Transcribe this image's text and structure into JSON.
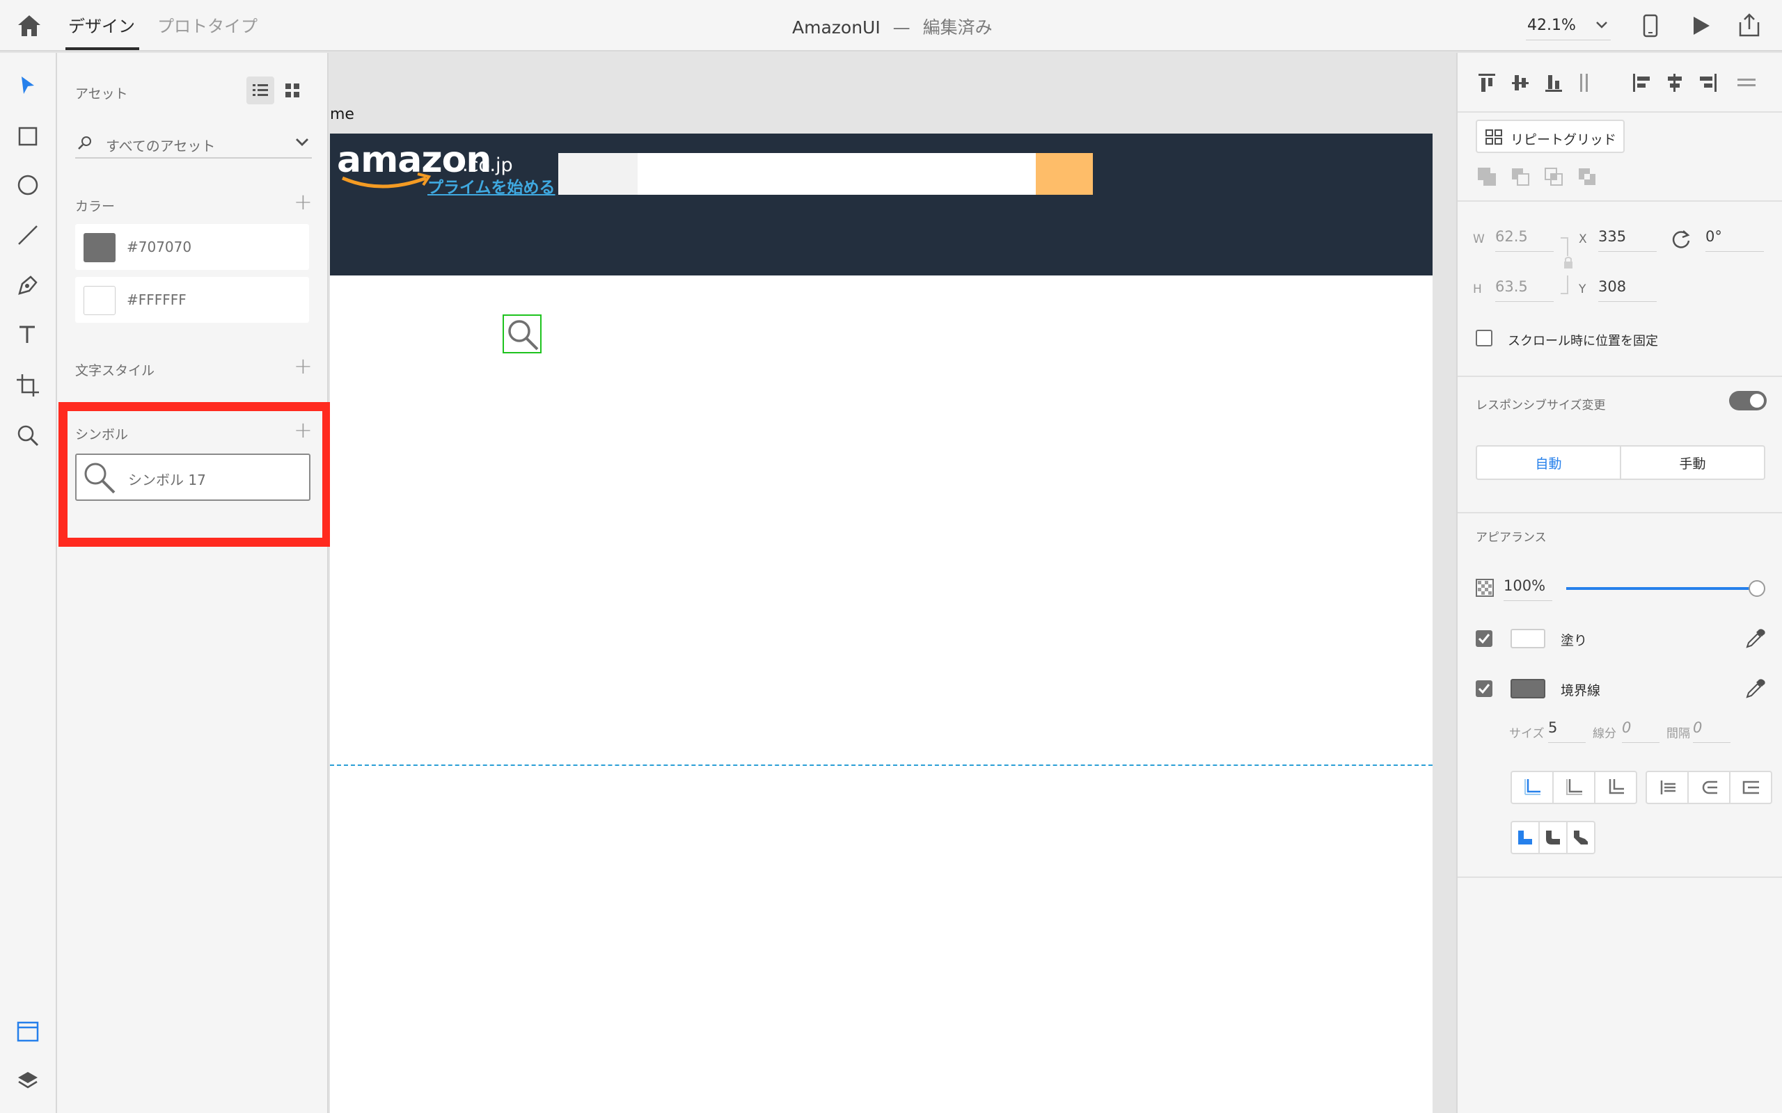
{
  "topbar": {
    "tabs": [
      {
        "label": "デザイン"
      },
      {
        "label": "プロトタイプ"
      }
    ],
    "doc_title": "AmazonUI",
    "separator": "—",
    "doc_status": "編集済み",
    "zoom": "42.1%"
  },
  "assets": {
    "title": "アセット",
    "filter_label": "すべてのアセット",
    "colors_title": "カラー",
    "colors": [
      {
        "hex": "#707070"
      },
      {
        "hex": "#FFFFFF"
      }
    ],
    "text_styles_title": "文字スタイル",
    "symbols_title": "シンボル",
    "symbols": [
      {
        "name": "シンボル 17"
      }
    ]
  },
  "canvas": {
    "artboard_label": "me",
    "amazon": {
      "logo": "amazon",
      "domain": ".co.jp",
      "prime_link": "プライムを始める",
      "header_color": "#232f3e",
      "search_btn_color": "#febd69"
    }
  },
  "inspector": {
    "repeat_grid_label": "リピートグリッド",
    "w_label": "W",
    "w_value": "62.5",
    "h_label": "H",
    "h_value": "63.5",
    "x_label": "X",
    "x_value": "335",
    "y_label": "Y",
    "y_value": "308",
    "rotation_value": "0°",
    "fix_scroll_label": "スクロール時に位置を固定",
    "responsive_label": "レスポンシブサイズ変更",
    "responsive_on": true,
    "resize_options": [
      {
        "label": "自動"
      },
      {
        "label": "手動"
      }
    ],
    "appearance_title": "アピアランス",
    "opacity_value": "100%",
    "opacity_fraction": 1.0,
    "fill_label": "塗り",
    "fill_color": "#FFFFFF",
    "border_label": "境界線",
    "border_color": "#707070",
    "size_label": "サイズ",
    "size_value": "5",
    "dash_label": "線分",
    "dash_value": "0",
    "gap_label": "間隔",
    "gap_value": "0"
  },
  "colors": {
    "accent": "#2680eb",
    "highlight": "#ff2a1f",
    "selection": "#1ec31e"
  }
}
